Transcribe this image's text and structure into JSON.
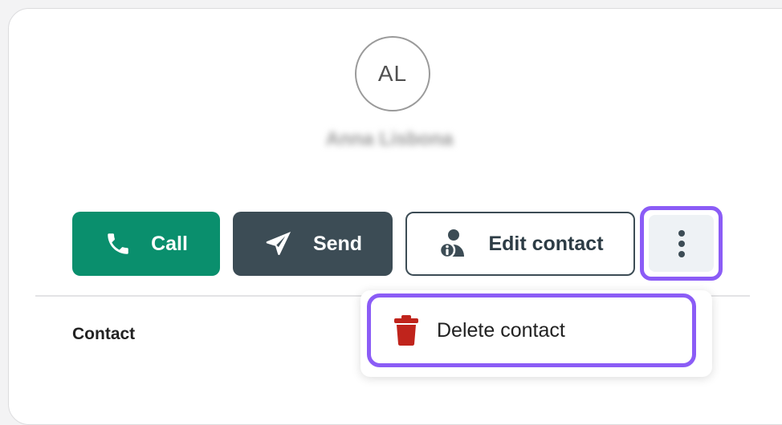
{
  "contact": {
    "initials": "AL",
    "name": "Anna Lisbona"
  },
  "actions": {
    "call_label": "Call",
    "send_label": "Send",
    "edit_label": "Edit contact",
    "more_icon": "more-vertical-icon"
  },
  "section": {
    "label": "Contact"
  },
  "menu": {
    "delete_label": "Delete contact",
    "delete_icon": "trash-icon"
  },
  "colors": {
    "call": "#0a8f6d",
    "send": "#3c4c55",
    "focus": "#8b5cf6",
    "delete": "#c0241c"
  }
}
